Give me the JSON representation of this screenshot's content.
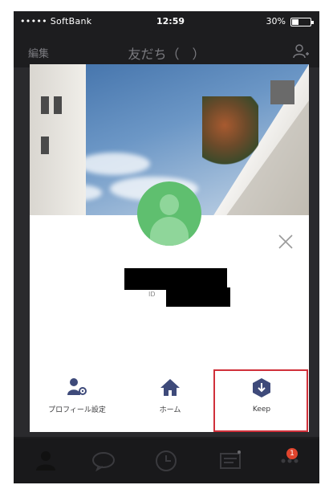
{
  "status_bar": {
    "carrier": "••••• SoftBank",
    "time": "12:59",
    "battery": "30%"
  },
  "nav": {
    "edit": "編集",
    "title": "友だち（　）"
  },
  "profile": {
    "id_label": "ID"
  },
  "actions": [
    {
      "label": "プロフィール設定",
      "icon": "profile-settings-icon"
    },
    {
      "label": "ホーム",
      "icon": "home-icon"
    },
    {
      "label": "Keep",
      "icon": "keep-icon"
    }
  ],
  "tab_bar": {
    "badge": "1"
  },
  "colors": {
    "highlight": "#d0303a",
    "avatar": "#5fbf6f",
    "action_icon": "#3e4a7a"
  }
}
